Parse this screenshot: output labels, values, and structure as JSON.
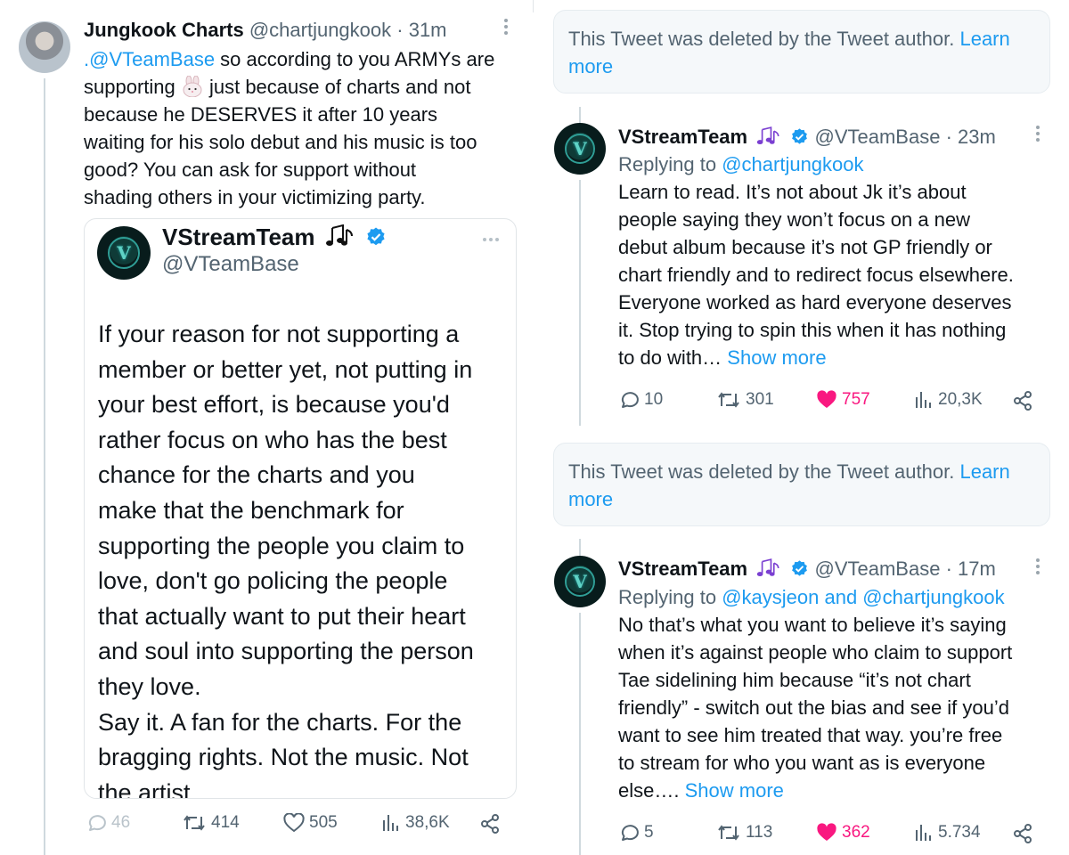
{
  "left_tweet": {
    "author_name": "Jungkook Charts",
    "handle": "@chartjungkook",
    "time": "· 31m",
    "body_lines": [
      ".@VTeamBase so according to you ARMYs are",
      "supporting 🐰 just because of charts and not",
      "because he DESERVES it after 10 years",
      "waiting for his solo debut and his music is too",
      "good? You can ask for support without",
      "shading others in your victimizing party."
    ],
    "mention": ".@VTeamBase",
    "quote": {
      "author_name": "VStreamTeam",
      "handle": "@VTeamBase",
      "body_lines": [
        "If your reason for not supporting a",
        "member or better yet, not putting in",
        "your best effort, is because you'd",
        "rather focus on who has the best",
        "chance for the charts and you",
        "make that the benchmark for",
        "supporting the people you claim to",
        "love, don't go policing the people",
        "that actually want to put their heart",
        "and soul into supporting the person",
        "they love.",
        "Say it. A fan for the charts. For the",
        "bragging rights. Not the music. Not",
        "the artist."
      ]
    },
    "stats": {
      "replies": "46",
      "retweets": "414",
      "likes": "505",
      "views": "38,6K"
    }
  },
  "right_panel": {
    "deleted_notice_1": {
      "text": "This Tweet was deleted by the Tweet author.",
      "link_1": "Learn",
      "link_2": "more"
    },
    "reply_1": {
      "author_name": "VStreamTeam",
      "handle": "@VTeamBase",
      "time": "· 23m",
      "replying_prefix": "Replying to",
      "replying_to": "@chartjungkook",
      "body_lines": [
        "Learn to read. It’s not about Jk it’s about",
        "people saying they won’t focus on a new",
        "debut album because it’s not GP friendly or",
        "chart friendly and to redirect focus elsewhere.",
        "Everyone worked as hard everyone deserves",
        "it. Stop trying to spin this when it has nothing",
        "to do with…"
      ],
      "show_more": "Show more",
      "stats": {
        "replies": "10",
        "retweets": "301",
        "likes": "757",
        "views": "20,3K"
      }
    },
    "deleted_notice_2": {
      "text": "This Tweet was deleted by the Tweet author.",
      "link_1": "Learn",
      "link_2": "more"
    },
    "reply_2": {
      "author_name": "VStreamTeam",
      "handle": "@VTeamBase",
      "time": "· 17m",
      "replying_prefix": "Replying to",
      "replying_to": "@kaysjeon and @chartjungkook",
      "body_lines": [
        "No that’s what you want to believe it’s saying",
        "when it’s against people who claim to support",
        "Tae sidelining him  because “it’s not chart",
        "friendly” - switch out the bias and see if you’d",
        "want to see him treated that way. you’re free",
        "to stream for who you want as is everyone",
        "else…."
      ],
      "show_more": "Show more",
      "stats": {
        "replies": "5",
        "retweets": "113",
        "likes": "362",
        "views": "5.734"
      }
    }
  },
  "colors": {
    "link_blue": "#1d9bf0",
    "like_pink": "#f91880",
    "muted": "#536471",
    "verified": "#1d9bf0"
  },
  "icons": [
    "reply-icon",
    "retweet-icon",
    "like-icon",
    "views-icon",
    "share-icon",
    "verified-badge-icon",
    "music-notes-icon",
    "more-options-icon",
    "rabbit-emoji"
  ]
}
